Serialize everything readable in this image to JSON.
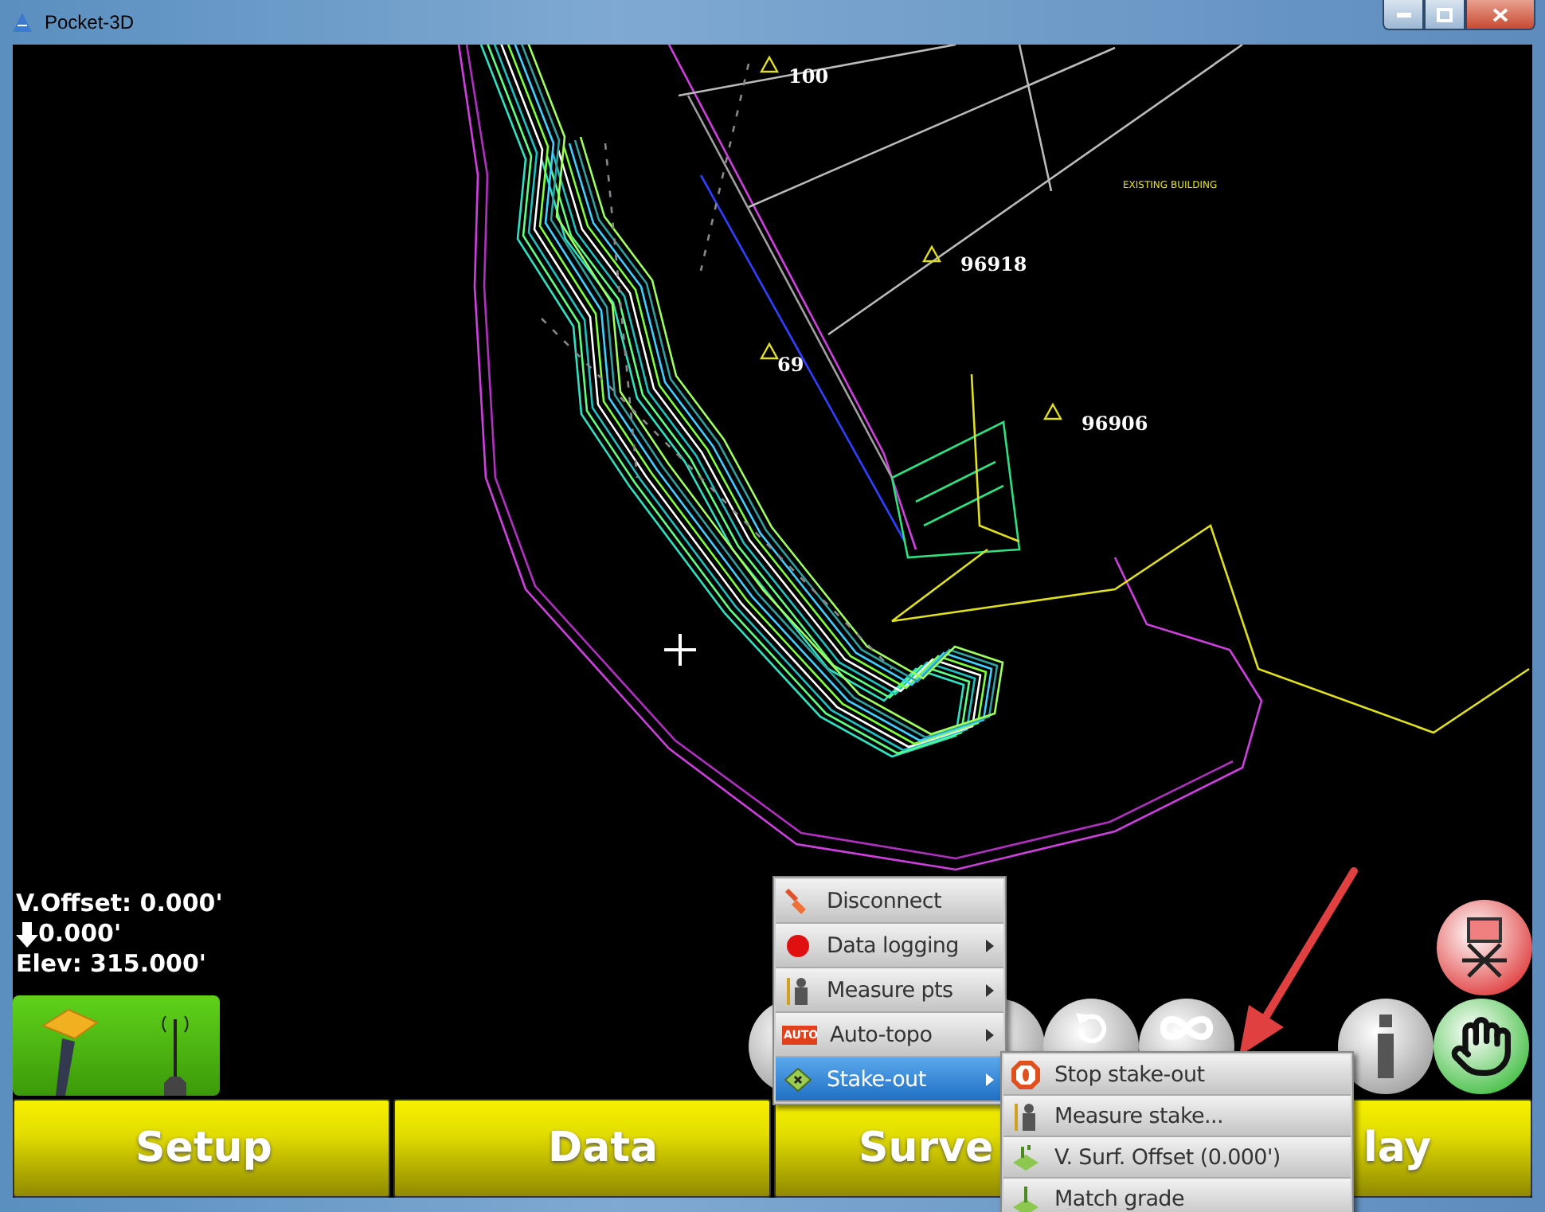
{
  "window": {
    "title": "Pocket-3D"
  },
  "map": {
    "point_labels": [
      {
        "text": "100"
      },
      {
        "text": "96918"
      },
      {
        "text": "69"
      },
      {
        "text": "96906"
      }
    ],
    "notes": [
      "EXISTING BUILDING"
    ]
  },
  "readouts": [
    {
      "kind": "text",
      "text": "V.Offset: 0.000'"
    },
    {
      "kind": "down",
      "text": "0.000'"
    },
    {
      "kind": "text",
      "text": "Elev: 315.000'"
    }
  ],
  "menu": {
    "items": [
      {
        "kind": "plug",
        "label": "Disconnect",
        "submenu": false,
        "selected": false
      },
      {
        "kind": "dot",
        "label": "Data logging",
        "submenu": true,
        "selected": false
      },
      {
        "kind": "surveyor",
        "label": "Measure pts",
        "submenu": true,
        "selected": false
      },
      {
        "kind": "auto",
        "badge": "AUTO",
        "label": "Auto-topo",
        "submenu": true,
        "selected": false
      },
      {
        "kind": "stake",
        "label": "Stake-out",
        "submenu": true,
        "selected": true
      }
    ]
  },
  "submenu": {
    "items": [
      {
        "kind": "stop",
        "label": "Stop stake-out"
      },
      {
        "kind": "surveyor",
        "label": "Measure stake..."
      },
      {
        "kind": "surface",
        "label": "V. Surf. Offset (0.000')"
      },
      {
        "kind": "grade",
        "label": "Match grade"
      }
    ]
  },
  "bottom_buttons": [
    {
      "label": "Setup"
    },
    {
      "label": "Data"
    },
    {
      "label": "Surve"
    },
    {
      "label": "lay"
    }
  ]
}
